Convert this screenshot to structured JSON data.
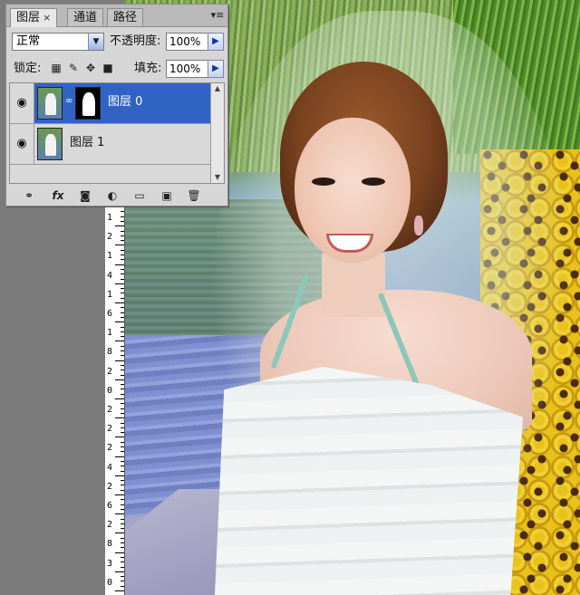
{
  "panel": {
    "tabs": [
      {
        "label": "图层",
        "close": "×",
        "active": true
      },
      {
        "label": "通道",
        "active": false
      },
      {
        "label": "路径",
        "active": false
      }
    ],
    "menu_icon": "panel-menu-icon",
    "blend_mode": "正常",
    "opacity_label": "不透明度:",
    "opacity_value": "100%",
    "lock_label": "锁定:",
    "fill_label": "填充:",
    "fill_value": "100%",
    "lock_icons": [
      "lock-transparent-icon",
      "lock-image-icon",
      "lock-position-icon",
      "lock-all-icon"
    ],
    "layers": [
      {
        "name": "图层 0",
        "selected": true,
        "has_mask": true
      },
      {
        "name": "图层 1",
        "selected": false,
        "has_mask": false
      }
    ],
    "bottom_icons": [
      "link-layers-icon",
      "fx-icon",
      "add-mask-icon",
      "adjustment-layer-icon",
      "new-group-icon",
      "new-layer-icon",
      "trash-icon"
    ]
  },
  "ruler": {
    "labels": [
      "1",
      "2",
      "1",
      "4",
      "1",
      "6",
      "1",
      "8",
      "2",
      "0",
      "2",
      "2",
      "2",
      "4",
      "2",
      "6",
      "2",
      "8",
      "3",
      "0"
    ]
  },
  "colors": {
    "selection": "#3163c4",
    "panel_bg": "#d6d6d6"
  }
}
